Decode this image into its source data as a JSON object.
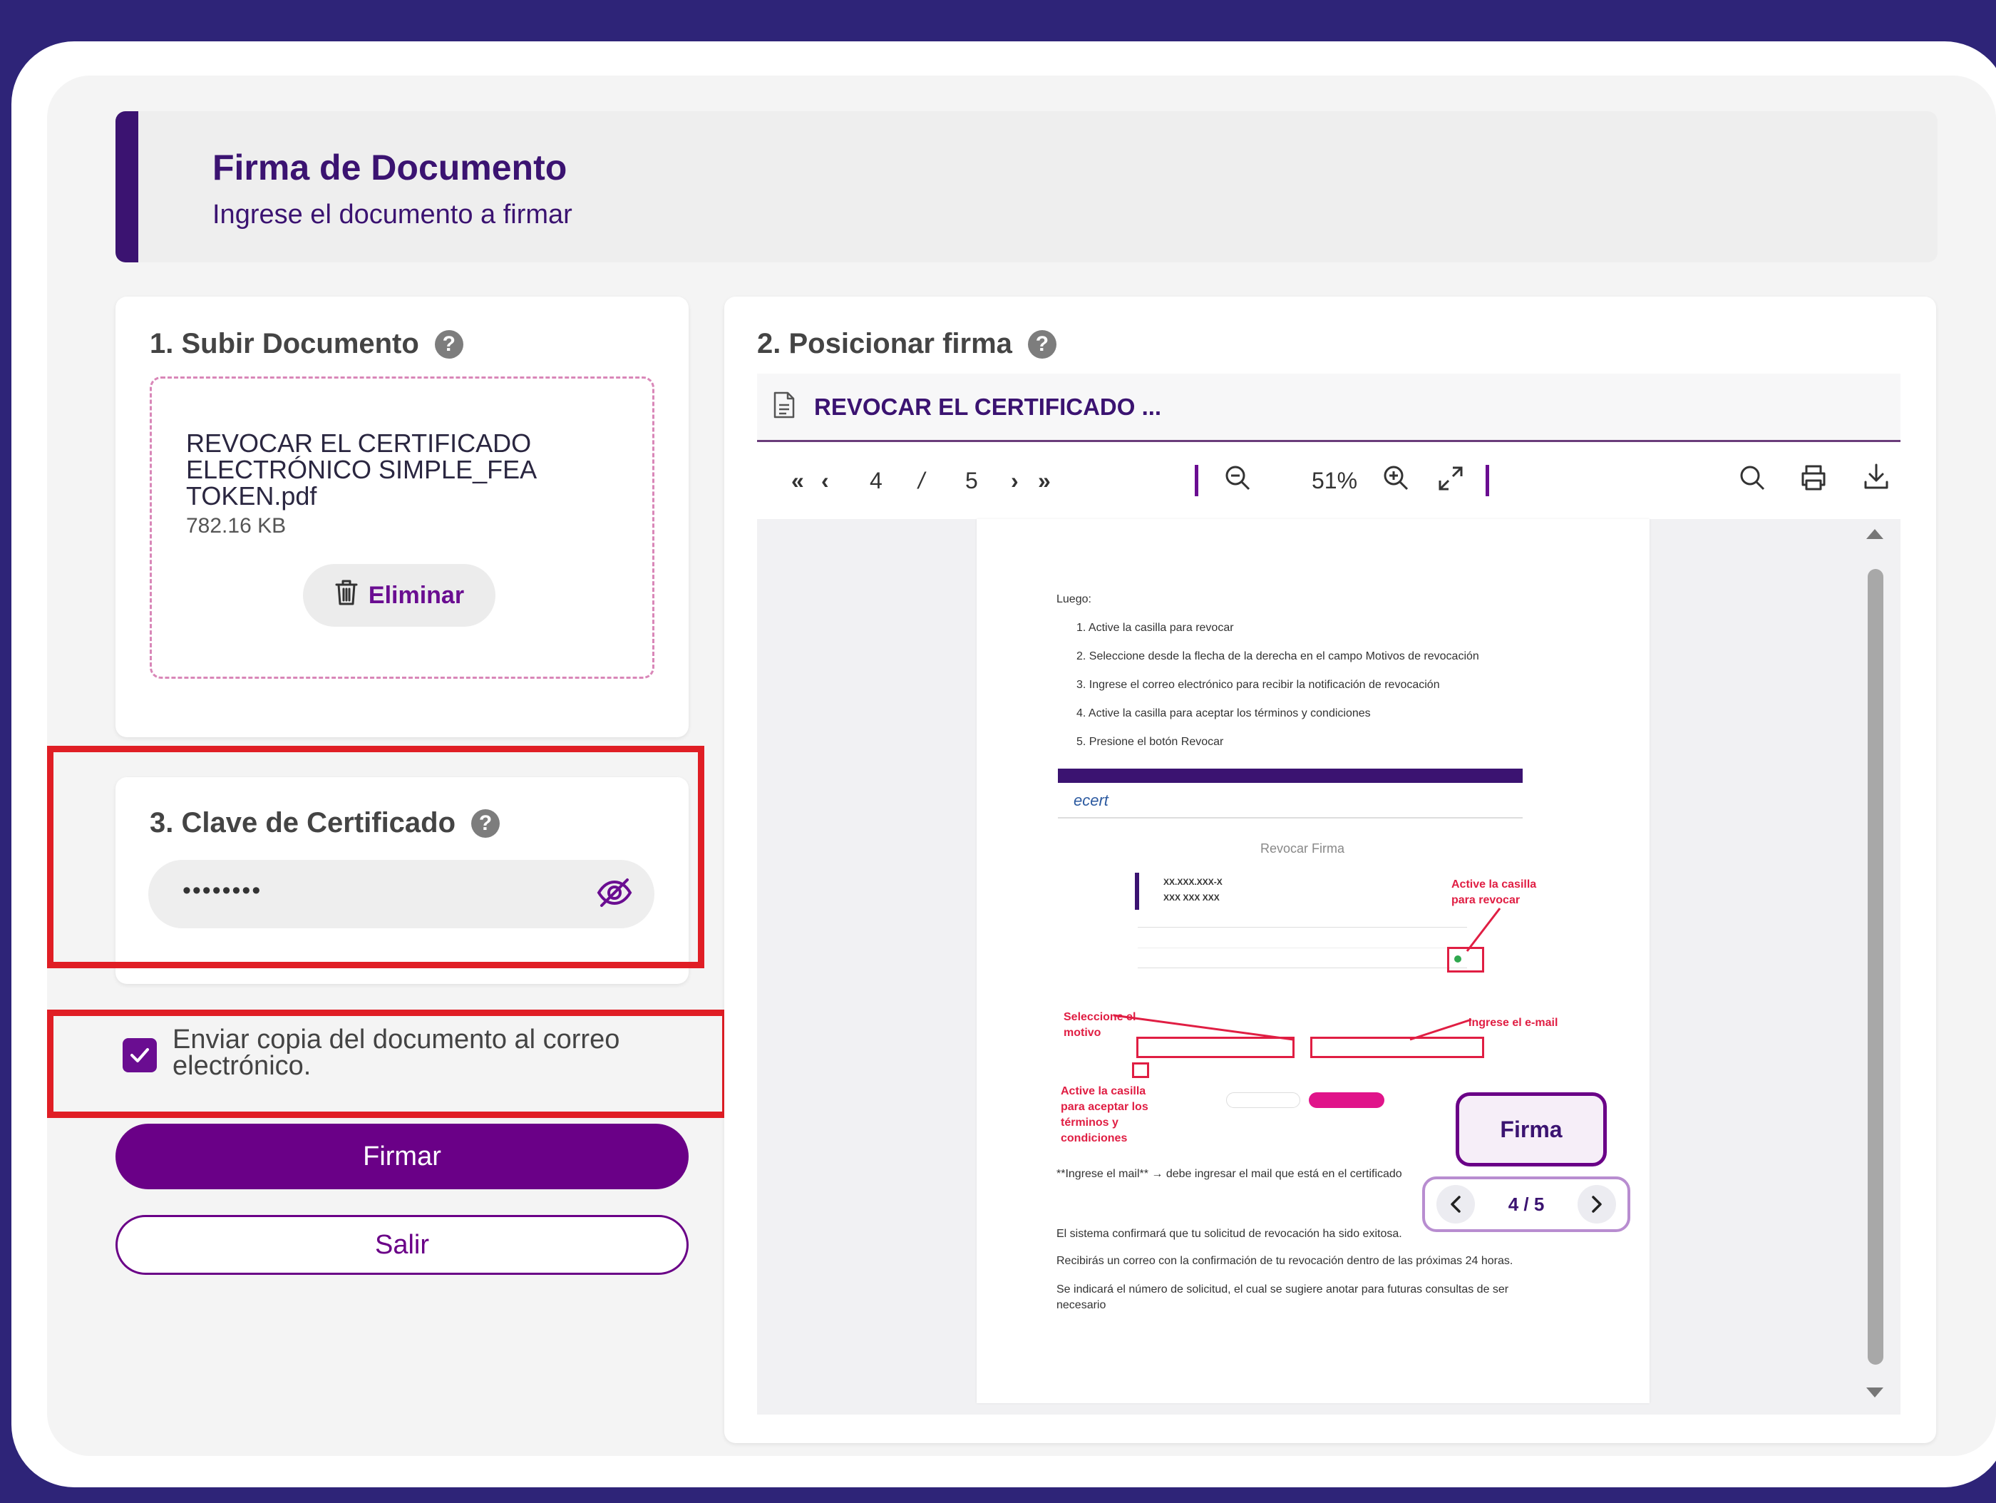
{
  "header": {
    "title": "Firma de Documento",
    "subtitle": "Ingrese el documento a firmar"
  },
  "upload": {
    "title": "1. Subir Documento",
    "file_name": "REVOCAR EL CERTIFICADO ELECTRÓNICO SIMPLE_FEA TOKEN.pdf",
    "file_size": "782.16 KB",
    "delete_label": "Eliminar"
  },
  "cert": {
    "title": "3. Clave de Certificado",
    "password_mask": "••••••••"
  },
  "email_copy": {
    "label": "Enviar copia del documento al correo electrónico.",
    "checked": true
  },
  "actions": {
    "sign_label": "Firmar",
    "exit_label": "Salir"
  },
  "position": {
    "title": "2. Posicionar firma",
    "doc_tab": "REVOCAR EL CERTIFICADO ...",
    "current_page": "4",
    "page_sep": "/",
    "total_pages": "5",
    "zoom": "51%"
  },
  "doc": {
    "luego": "Luego:",
    "steps": [
      "1.  Active la casilla para revocar",
      "2.  Seleccione desde la flecha de la derecha en el campo Motivos de revocación",
      "3.  Ingrese el correo electrónico para recibir la notificación de revocación",
      "4.  Active la casilla para aceptar los términos y condiciones",
      "5.  Presione el botón Revocar"
    ],
    "brand": "ecert",
    "revocar_title": "Revocar Firma",
    "rut_label": "XX.XXX.XXX-X",
    "name_label": "XXX XXX XXX",
    "note_active_revocar": "Active la casilla para revocar",
    "note_motivo": "Seleccione el motivo",
    "note_email": "Ingrese el e-mail",
    "note_terms": "Active la casilla para aceptar los términos y condiciones",
    "mail_line": "**Ingrese el mail** → debe ingresar el mail que está en el certificado",
    "confirm_lines": [
      "El sistema confirmará que tu solicitud de revocación ha sido exitosa.",
      "Recibirás un correo con la confirmación de tu revocación dentro de las próximas 24 horas.",
      "Se indicará el número de solicitud, el cual se sugiere anotar para futuras consultas de ser",
      "necesario"
    ]
  },
  "stamp": {
    "label": "Firma",
    "pager_text": "4 / 5"
  },
  "colors": {
    "brand": "#6a0087",
    "dark": "#3b1371",
    "highlight": "#e01e25",
    "background": "#2e2478"
  }
}
